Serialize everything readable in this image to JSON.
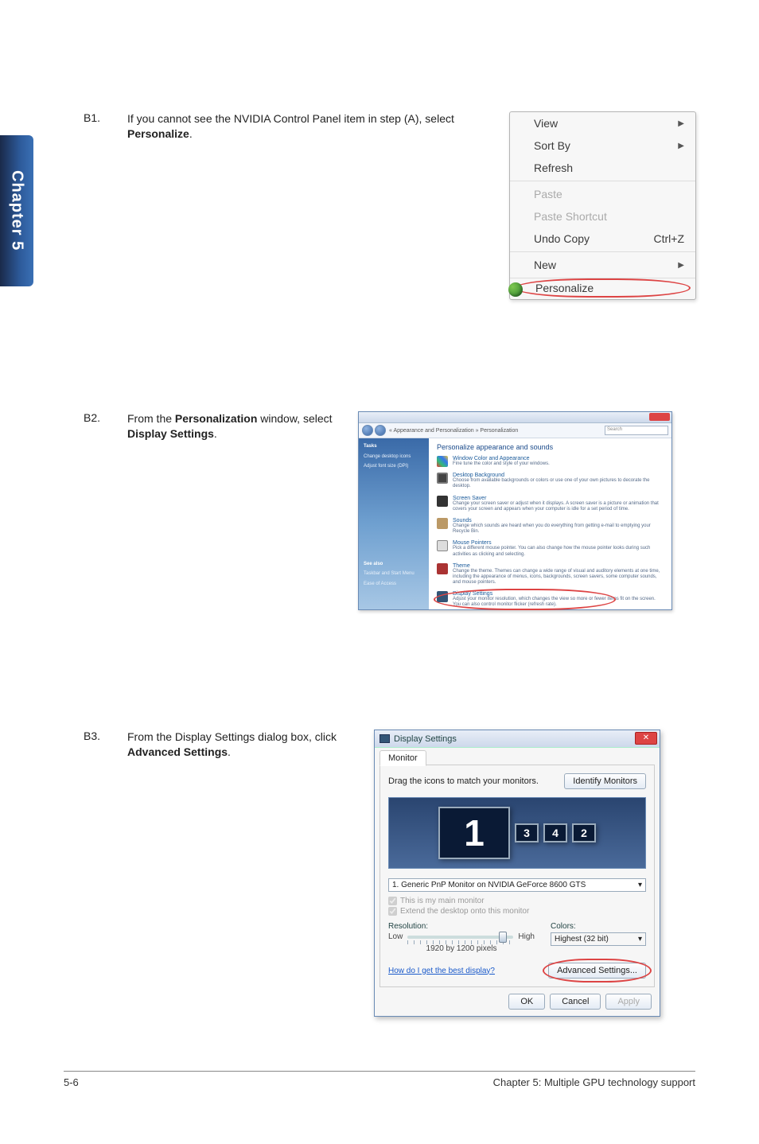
{
  "chapter_tab": "Chapter 5",
  "steps": {
    "b1": {
      "num": "B1.",
      "text_pre": "If you cannot see the NVIDIA Control Panel item in step (A), select ",
      "text_bold": "Personalize",
      "text_post": "."
    },
    "b2": {
      "num": "B2.",
      "text_pre": "From the ",
      "text_bold1": "Personalization",
      "text_mid": " window, select ",
      "text_bold2": "Display Settings",
      "text_post": "."
    },
    "b3": {
      "num": "B3.",
      "text_pre": "From the Display Settings dialog box, click ",
      "text_bold": "Advanced Settings",
      "text_post": "."
    }
  },
  "context_menu": {
    "view": "View",
    "sort_by": "Sort By",
    "refresh": "Refresh",
    "paste": "Paste",
    "paste_shortcut": "Paste Shortcut",
    "undo_copy": "Undo Copy",
    "undo_shortcut": "Ctrl+Z",
    "new": "New",
    "personalize": "Personalize"
  },
  "pers": {
    "breadcrumb": "« Appearance and Personalization » Personalization",
    "search_placeholder": "Search",
    "side_heading": "Tasks",
    "side_link1": "Change desktop icons",
    "side_link2": "Adjust font size (DPI)",
    "side_seealso": "See also",
    "side_seealso1": "Taskbar and Start Menu",
    "side_seealso2": "Ease of Access",
    "main_heading": "Personalize appearance and sounds",
    "items": [
      {
        "title": "Window Color and Appearance",
        "desc": "Fine tune the color and style of your windows."
      },
      {
        "title": "Desktop Background",
        "desc": "Choose from available backgrounds or colors or use one of your own pictures to decorate the desktop."
      },
      {
        "title": "Screen Saver",
        "desc": "Change your screen saver or adjust when it displays. A screen saver is a picture or animation that covers your screen and appears when your computer is idle for a set period of time."
      },
      {
        "title": "Sounds",
        "desc": "Change which sounds are heard when you do everything from getting e-mail to emptying your Recycle Bin."
      },
      {
        "title": "Mouse Pointers",
        "desc": "Pick a different mouse pointer. You can also change how the mouse pointer looks during such activities as clicking and selecting."
      },
      {
        "title": "Theme",
        "desc": "Change the theme. Themes can change a wide range of visual and auditory elements at one time, including the appearance of menus, icons, backgrounds, screen savers, some computer sounds, and mouse pointers."
      },
      {
        "title": "Display Settings",
        "desc": "Adjust your monitor resolution, which changes the view so more or fewer items fit on the screen. You can also control monitor flicker (refresh rate)."
      }
    ]
  },
  "ds": {
    "title": "Display Settings",
    "tab": "Monitor",
    "drag_text": "Drag the icons to match your monitors.",
    "identify": "Identify Monitors",
    "monitors": [
      "1",
      "3",
      "4",
      "2"
    ],
    "monitor_select": "1. Generic PnP Monitor on NVIDIA GeForce 8600 GTS",
    "chk_main": "This is my main monitor",
    "chk_extend": "Extend the desktop onto this monitor",
    "res_label": "Resolution:",
    "res_low": "Low",
    "res_high": "High",
    "res_value": "1920 by 1200 pixels",
    "colors_label": "Colors:",
    "colors_value": "Highest (32 bit)",
    "help_link": "How do I get the best display?",
    "adv": "Advanced Settings...",
    "ok": "OK",
    "cancel": "Cancel",
    "apply": "Apply"
  },
  "footer": {
    "left": "5-6",
    "right": "Chapter 5: Multiple GPU technology support"
  }
}
